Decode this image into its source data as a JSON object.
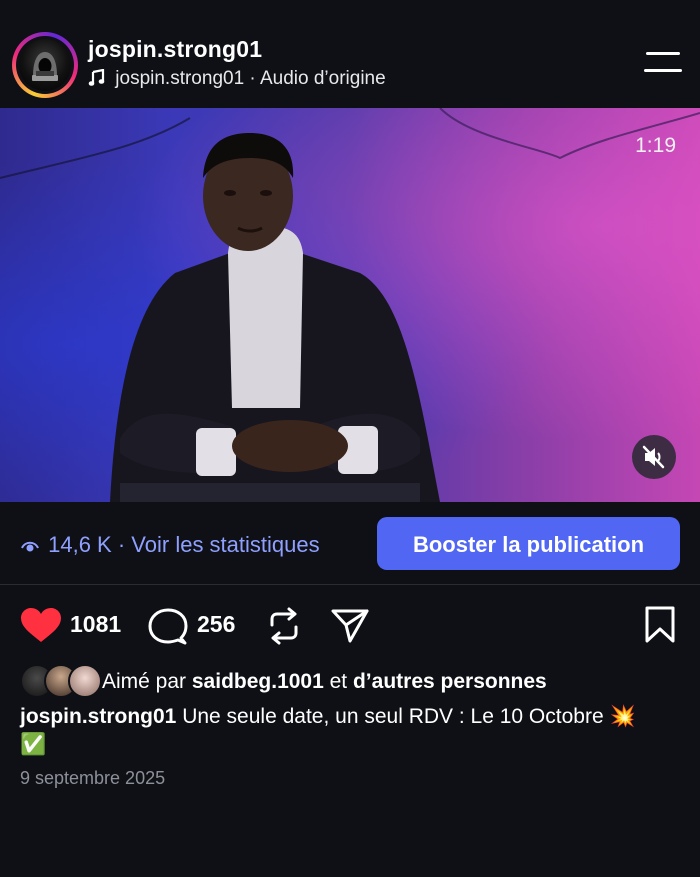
{
  "header": {
    "username": "jospin.strong01",
    "audio": "jospin.strong01 · Audio d’origine"
  },
  "video": {
    "duration": "1:19"
  },
  "stats": {
    "views": "14,6 K",
    "views_separator": " · ",
    "view_stats_label": "Voir les statistiques",
    "boost_label": "Booster la publication"
  },
  "actions": {
    "likes": "1081",
    "comments": "256"
  },
  "liked_by": {
    "prefix": "Aimé par",
    "user": "saidbeg.1001",
    "connector": "et",
    "others": "d’autres personnes"
  },
  "caption": {
    "username": "jospin.strong01",
    "text": "Une seule date, un seul RDV : Le 10 Octobre 💥 ✅"
  },
  "date": "9 septembre 2025",
  "colors": {
    "background": "#0e1016",
    "accent": "#5167f3",
    "link": "#8fa0ff",
    "like": "#ff3040"
  }
}
